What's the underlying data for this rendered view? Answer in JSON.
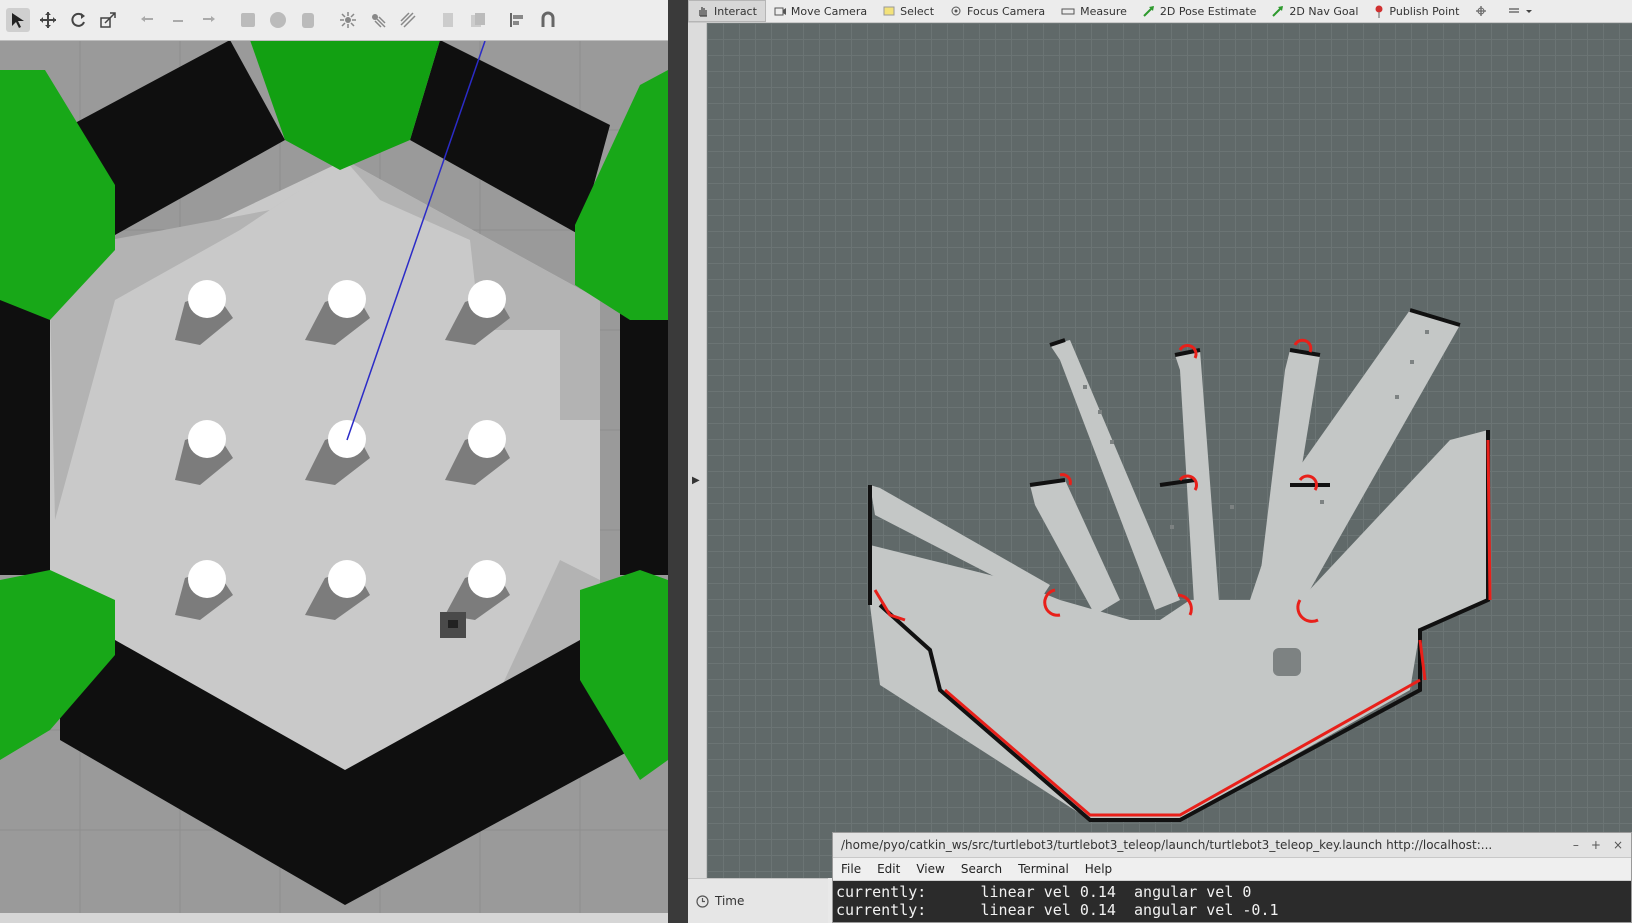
{
  "gazebo": {
    "toolbar_icons": [
      "select-arrow-icon",
      "translate-icon",
      "rotate-icon",
      "scale-icon",
      "undo-icon",
      "redo-icon",
      "redo-alt-icon",
      "box-icon",
      "sphere-icon",
      "cylinder-icon",
      "point-light-icon",
      "spot-light-icon",
      "directional-light-icon",
      "copy-icon",
      "paste-icon",
      "align-icon",
      "snap-icon"
    ]
  },
  "rviz": {
    "toolbar": [
      {
        "label": "Interact",
        "icon": "hand-icon",
        "active": true
      },
      {
        "label": "Move Camera",
        "icon": "move-camera-icon",
        "active": false
      },
      {
        "label": "Select",
        "icon": "select-box-icon",
        "active": false
      },
      {
        "label": "Focus Camera",
        "icon": "focus-camera-icon",
        "active": false
      },
      {
        "label": "Measure",
        "icon": "ruler-icon",
        "active": false
      },
      {
        "label": "2D Pose Estimate",
        "icon": "green-arrow-icon",
        "active": false
      },
      {
        "label": "2D Nav Goal",
        "icon": "green-arrow-icon",
        "active": false
      },
      {
        "label": "Publish Point",
        "icon": "pin-icon",
        "active": false
      }
    ],
    "time_label": "Time"
  },
  "terminal": {
    "title": "/home/pyo/catkin_ws/src/turtlebot3/turtlebot3_teleop/launch/turtlebot3_teleop_key.launch http://localhost:...",
    "menu": [
      "File",
      "Edit",
      "View",
      "Search",
      "Terminal",
      "Help"
    ],
    "lines": [
      "currently:      linear vel 0.14  angular vel 0",
      "currently:      linear vel 0.14  angular vel -0.1"
    ]
  }
}
